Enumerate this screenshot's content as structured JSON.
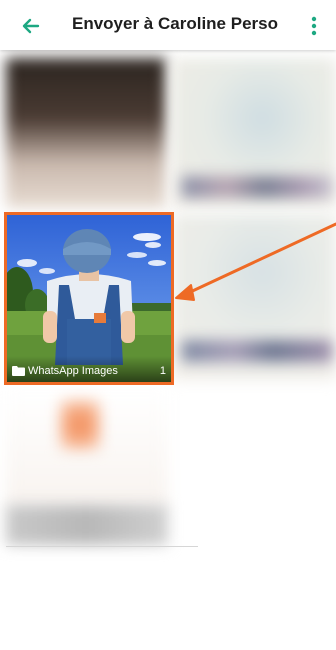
{
  "header": {
    "title": "Envoyer à Caroline Perso",
    "back_icon": "arrow-left-icon",
    "menu_icon": "more-vertical-icon"
  },
  "folders": [
    {
      "name": "WhatsApp Images",
      "count": "1",
      "icon": "folder-icon"
    }
  ],
  "colors": {
    "accent": "#1da882",
    "highlight": "#ee6a25"
  }
}
